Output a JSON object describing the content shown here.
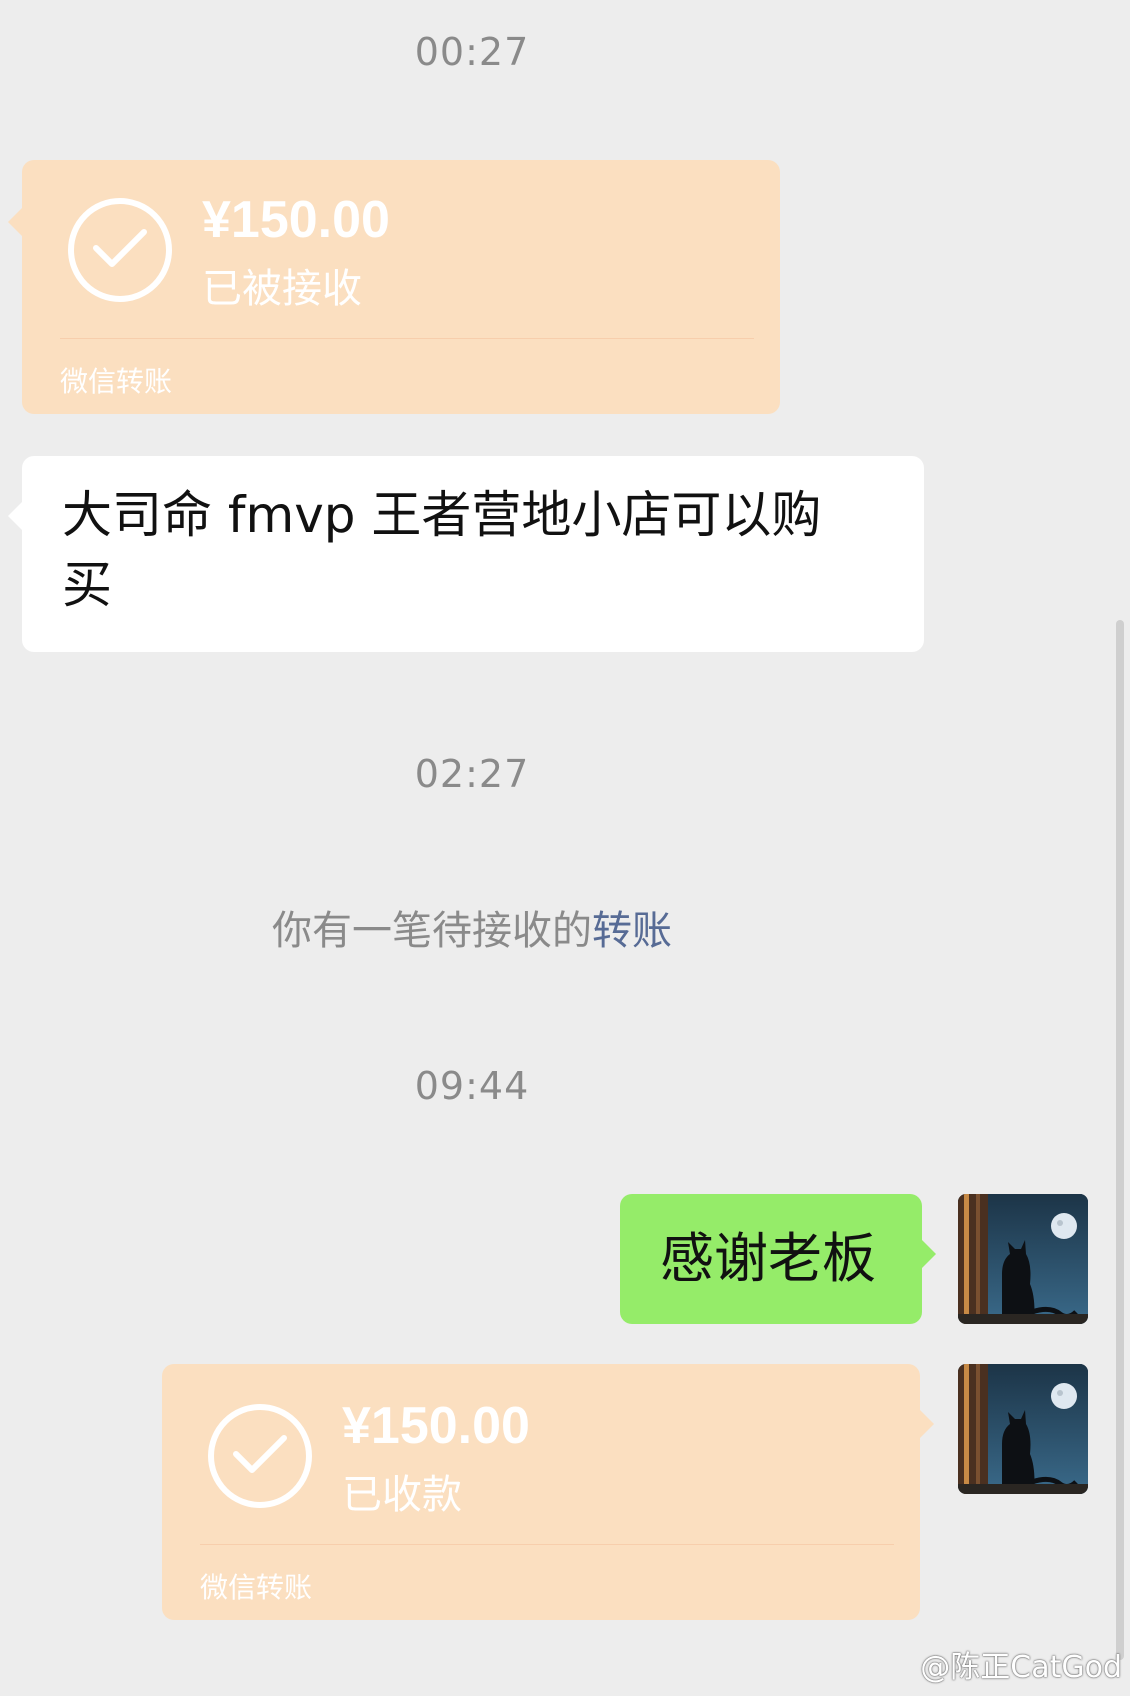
{
  "chat": {
    "timestamps": [
      "00:27",
      "02:27",
      "09:44"
    ],
    "transfer_received": {
      "amount": "¥150.00",
      "status": "已被接收",
      "source": "微信转账"
    },
    "incoming_text": {
      "line1": "大司命 fmvp  王者营地小店可以购",
      "line2": "买"
    },
    "system_notice": {
      "prefix": "你有一笔待接收的",
      "link": "转账"
    },
    "outgoing_text": "感谢老板",
    "transfer_collected": {
      "amount": "¥150.00",
      "status": "已收款",
      "source": "微信转账"
    }
  },
  "watermark": "@陈正CatGod",
  "colors": {
    "transfer_bg": "#fbdfc0",
    "sent_bubble": "#95ec69",
    "link": "#576b95",
    "background": "#ededed"
  },
  "icons": {
    "check": "check-circle-icon",
    "avatar": "cat-moon-avatar"
  }
}
